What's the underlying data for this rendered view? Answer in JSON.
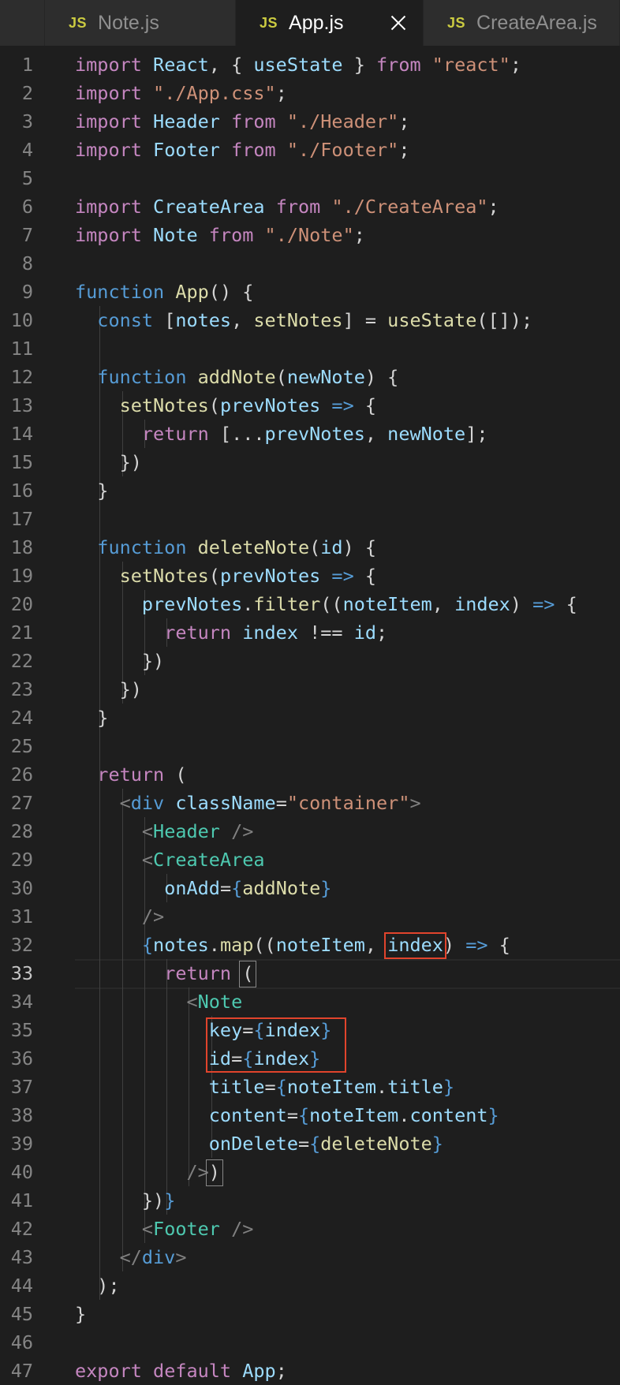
{
  "tabs": [
    {
      "icon": "JS",
      "label": "Note.js",
      "active": false
    },
    {
      "icon": "JS",
      "label": "App.js",
      "active": true
    },
    {
      "icon": "JS",
      "label": "CreateArea.js",
      "active": false
    }
  ],
  "colors": {
    "keyword": "#c586c0",
    "string": "#ce9178",
    "variable": "#9cdcfe",
    "function": "#dcdcaa",
    "storage": "#569cd6",
    "component": "#4ec9b0",
    "punctuation": "#d4d4d4",
    "annotation_box": "#e1442c"
  },
  "editor": {
    "current_line": 33,
    "lines": [
      {
        "n": "1",
        "t": [
          [
            "k",
            "import "
          ],
          [
            "v",
            "React"
          ],
          [
            "w",
            ", { "
          ],
          [
            "v",
            "useState"
          ],
          [
            "w",
            " } "
          ],
          [
            "k",
            "from "
          ],
          [
            "s",
            "\"react\""
          ],
          [
            "w",
            ";"
          ]
        ]
      },
      {
        "n": "2",
        "t": [
          [
            "k",
            "import "
          ],
          [
            "s",
            "\"./App.css\""
          ],
          [
            "w",
            ";"
          ]
        ]
      },
      {
        "n": "3",
        "t": [
          [
            "k",
            "import "
          ],
          [
            "v",
            "Header "
          ],
          [
            "k",
            "from "
          ],
          [
            "s",
            "\"./Header\""
          ],
          [
            "w",
            ";"
          ]
        ]
      },
      {
        "n": "4",
        "t": [
          [
            "k",
            "import "
          ],
          [
            "v",
            "Footer "
          ],
          [
            "k",
            "from "
          ],
          [
            "s",
            "\"./Footer\""
          ],
          [
            "w",
            ";"
          ]
        ]
      },
      {
        "n": "5",
        "t": []
      },
      {
        "n": "6",
        "t": [
          [
            "k",
            "import "
          ],
          [
            "v",
            "CreateArea "
          ],
          [
            "k",
            "from "
          ],
          [
            "s",
            "\"./CreateArea\""
          ],
          [
            "w",
            ";"
          ]
        ]
      },
      {
        "n": "7",
        "t": [
          [
            "k",
            "import "
          ],
          [
            "v",
            "Note "
          ],
          [
            "k",
            "from "
          ],
          [
            "s",
            "\"./Note\""
          ],
          [
            "w",
            ";"
          ]
        ]
      },
      {
        "n": "8",
        "t": []
      },
      {
        "n": "9",
        "t": [
          [
            "b",
            "function "
          ],
          [
            "f",
            "App"
          ],
          [
            "w",
            "() {"
          ]
        ]
      },
      {
        "n": "10",
        "t": [
          [
            "w",
            "  "
          ],
          [
            "b",
            "const "
          ],
          [
            "w",
            "["
          ],
          [
            "v",
            "notes"
          ],
          [
            "w",
            ", "
          ],
          [
            "f",
            "setNotes"
          ],
          [
            "w",
            "] = "
          ],
          [
            "f",
            "useState"
          ],
          [
            "w",
            "([]);"
          ]
        ]
      },
      {
        "n": "11",
        "t": []
      },
      {
        "n": "12",
        "t": [
          [
            "w",
            "  "
          ],
          [
            "b",
            "function "
          ],
          [
            "f",
            "addNote"
          ],
          [
            "w",
            "("
          ],
          [
            "v",
            "newNote"
          ],
          [
            "w",
            ") {"
          ]
        ]
      },
      {
        "n": "13",
        "t": [
          [
            "w",
            "    "
          ],
          [
            "f",
            "setNotes"
          ],
          [
            "w",
            "("
          ],
          [
            "v",
            "prevNotes "
          ],
          [
            "b",
            "=> "
          ],
          [
            "w",
            "{"
          ]
        ]
      },
      {
        "n": "14",
        "t": [
          [
            "w",
            "      "
          ],
          [
            "k",
            "return "
          ],
          [
            "w",
            "[..."
          ],
          [
            "v",
            "prevNotes"
          ],
          [
            "w",
            ", "
          ],
          [
            "v",
            "newNote"
          ],
          [
            "w",
            "];"
          ]
        ]
      },
      {
        "n": "15",
        "t": [
          [
            "w",
            "    })"
          ]
        ]
      },
      {
        "n": "16",
        "t": [
          [
            "w",
            "  }"
          ]
        ]
      },
      {
        "n": "17",
        "t": []
      },
      {
        "n": "18",
        "t": [
          [
            "w",
            "  "
          ],
          [
            "b",
            "function "
          ],
          [
            "f",
            "deleteNote"
          ],
          [
            "w",
            "("
          ],
          [
            "v",
            "id"
          ],
          [
            "w",
            ") {"
          ]
        ]
      },
      {
        "n": "19",
        "t": [
          [
            "w",
            "    "
          ],
          [
            "f",
            "setNotes"
          ],
          [
            "w",
            "("
          ],
          [
            "v",
            "prevNotes "
          ],
          [
            "b",
            "=> "
          ],
          [
            "w",
            "{"
          ]
        ]
      },
      {
        "n": "20",
        "t": [
          [
            "w",
            "      "
          ],
          [
            "v",
            "prevNotes"
          ],
          [
            "w",
            "."
          ],
          [
            "f",
            "filter"
          ],
          [
            "w",
            "(("
          ],
          [
            "v",
            "noteItem"
          ],
          [
            "w",
            ", "
          ],
          [
            "v",
            "index"
          ],
          [
            "w",
            ") "
          ],
          [
            "b",
            "=> "
          ],
          [
            "w",
            "{"
          ]
        ]
      },
      {
        "n": "21",
        "t": [
          [
            "w",
            "        "
          ],
          [
            "k",
            "return "
          ],
          [
            "v",
            "index "
          ],
          [
            "w",
            "!== "
          ],
          [
            "v",
            "id"
          ],
          [
            "w",
            ";"
          ]
        ]
      },
      {
        "n": "22",
        "t": [
          [
            "w",
            "      })"
          ]
        ]
      },
      {
        "n": "23",
        "t": [
          [
            "w",
            "    })"
          ]
        ]
      },
      {
        "n": "24",
        "t": [
          [
            "w",
            "  }"
          ]
        ]
      },
      {
        "n": "25",
        "t": []
      },
      {
        "n": "26",
        "t": [
          [
            "w",
            "  "
          ],
          [
            "k",
            "return "
          ],
          [
            "w",
            "("
          ]
        ]
      },
      {
        "n": "27",
        "t": [
          [
            "w",
            "    "
          ],
          [
            "g",
            "<"
          ],
          [
            "b",
            "div "
          ],
          [
            "v",
            "className"
          ],
          [
            "w",
            "="
          ],
          [
            "s",
            "\"container\""
          ],
          [
            "g",
            ">"
          ]
        ]
      },
      {
        "n": "28",
        "t": [
          [
            "w",
            "      "
          ],
          [
            "g",
            "<"
          ],
          [
            "t",
            "Header "
          ],
          [
            "g",
            "/>"
          ]
        ]
      },
      {
        "n": "29",
        "t": [
          [
            "w",
            "      "
          ],
          [
            "g",
            "<"
          ],
          [
            "t",
            "CreateArea"
          ]
        ]
      },
      {
        "n": "30",
        "t": [
          [
            "w",
            "        "
          ],
          [
            "v",
            "onAdd"
          ],
          [
            "w",
            "="
          ],
          [
            "b",
            "{"
          ],
          [
            "f",
            "addNote"
          ],
          [
            "b",
            "}"
          ]
        ]
      },
      {
        "n": "31",
        "t": [
          [
            "w",
            "      "
          ],
          [
            "g",
            "/>"
          ]
        ]
      },
      {
        "n": "32",
        "t": [
          [
            "w",
            "      "
          ],
          [
            "b",
            "{"
          ],
          [
            "v",
            "notes"
          ],
          [
            "w",
            "."
          ],
          [
            "f",
            "map"
          ],
          [
            "w",
            "(("
          ],
          [
            "v",
            "noteItem"
          ],
          [
            "w",
            ", "
          ],
          [
            "v",
            "index"
          ],
          [
            "w",
            ") "
          ],
          [
            "b",
            "=> "
          ],
          [
            "w",
            "{"
          ]
        ]
      },
      {
        "n": "33",
        "t": [
          [
            "w",
            "        "
          ],
          [
            "k",
            "return "
          ],
          [
            "w",
            "("
          ]
        ]
      },
      {
        "n": "34",
        "t": [
          [
            "w",
            "          "
          ],
          [
            "g",
            "<"
          ],
          [
            "t",
            "Note"
          ]
        ]
      },
      {
        "n": "35",
        "t": [
          [
            "w",
            "            "
          ],
          [
            "v",
            "key"
          ],
          [
            "w",
            "="
          ],
          [
            "b",
            "{"
          ],
          [
            "v",
            "index"
          ],
          [
            "b",
            "}"
          ]
        ]
      },
      {
        "n": "36",
        "t": [
          [
            "w",
            "            "
          ],
          [
            "v",
            "id"
          ],
          [
            "w",
            "="
          ],
          [
            "b",
            "{"
          ],
          [
            "v",
            "index"
          ],
          [
            "b",
            "}"
          ]
        ]
      },
      {
        "n": "37",
        "t": [
          [
            "w",
            "            "
          ],
          [
            "v",
            "title"
          ],
          [
            "w",
            "="
          ],
          [
            "b",
            "{"
          ],
          [
            "v",
            "noteItem"
          ],
          [
            "w",
            "."
          ],
          [
            "v",
            "title"
          ],
          [
            "b",
            "}"
          ]
        ]
      },
      {
        "n": "38",
        "t": [
          [
            "w",
            "            "
          ],
          [
            "v",
            "content"
          ],
          [
            "w",
            "="
          ],
          [
            "b",
            "{"
          ],
          [
            "v",
            "noteItem"
          ],
          [
            "w",
            "."
          ],
          [
            "v",
            "content"
          ],
          [
            "b",
            "}"
          ]
        ]
      },
      {
        "n": "39",
        "t": [
          [
            "w",
            "            "
          ],
          [
            "v",
            "onDelete"
          ],
          [
            "w",
            "="
          ],
          [
            "b",
            "{"
          ],
          [
            "f",
            "deleteNote"
          ],
          [
            "b",
            "}"
          ]
        ]
      },
      {
        "n": "40",
        "t": [
          [
            "w",
            "          "
          ],
          [
            "g",
            "/>"
          ],
          [
            "w",
            ")"
          ]
        ]
      },
      {
        "n": "41",
        "t": [
          [
            "w",
            "      })"
          ],
          [
            "b",
            "}"
          ]
        ]
      },
      {
        "n": "42",
        "t": [
          [
            "w",
            "      "
          ],
          [
            "g",
            "<"
          ],
          [
            "t",
            "Footer "
          ],
          [
            "g",
            "/>"
          ]
        ]
      },
      {
        "n": "43",
        "t": [
          [
            "w",
            "    "
          ],
          [
            "g",
            "</"
          ],
          [
            "b",
            "div"
          ],
          [
            "g",
            ">"
          ]
        ]
      },
      {
        "n": "44",
        "t": [
          [
            "w",
            "  );"
          ]
        ]
      },
      {
        "n": "45",
        "t": [
          [
            "w",
            "}"
          ]
        ]
      },
      {
        "n": "46",
        "t": []
      },
      {
        "n": "47",
        "t": [
          [
            "k",
            "export "
          ],
          [
            "k",
            "default "
          ],
          [
            "v",
            "App"
          ],
          [
            "w",
            ";"
          ]
        ]
      }
    ]
  }
}
